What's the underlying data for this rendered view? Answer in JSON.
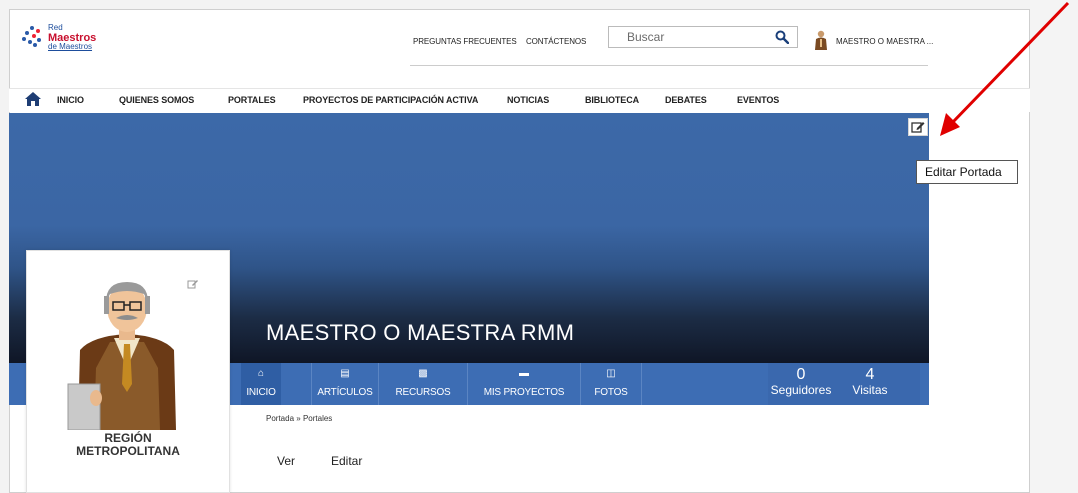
{
  "logo": {
    "line1": "Red",
    "line2": "Maestros",
    "line3": "de Maestros"
  },
  "header": {
    "faq": "PREGUNTAS FRECUENTES",
    "contact": "CONTÁCTENOS",
    "search_placeholder": "Buscar",
    "user_name": "MAESTRO O MAESTRA ..."
  },
  "nav": {
    "items": [
      "INICIO",
      "QUIENES SOMOS",
      "PORTALES",
      "PROYECTOS DE PARTICIPACIÓN ACTIVA",
      "NOTICIAS",
      "BIBLIOTECA",
      "DEBATES",
      "EVENTOS"
    ]
  },
  "banner": {
    "tooltip": "Editar Portada",
    "title": "MAESTRO O MAESTRA RMM"
  },
  "tabs": [
    {
      "label": "INICIO",
      "icon": "home-icon"
    },
    {
      "label": "ARTÍCULOS",
      "icon": "article-icon"
    },
    {
      "label": "RECURSOS",
      "icon": "briefcase-icon"
    },
    {
      "label": "MIS PROYECTOS",
      "icon": "folder-icon"
    },
    {
      "label": "FOTOS",
      "icon": "photos-icon"
    }
  ],
  "stats": {
    "followers_count": "0",
    "followers_label": "Seguidores",
    "visits_count": "4",
    "visits_label": "Visitas"
  },
  "profile": {
    "region_line1": "REGIÓN",
    "region_line2": "METROPOLITANA"
  },
  "breadcrumb": {
    "home": "Portada",
    "separator": "»",
    "current": "Portales"
  },
  "actions": {
    "view": "Ver",
    "edit": "Editar"
  },
  "colors": {
    "brand_blue": "#3d6db4",
    "brand_red": "#c8102e",
    "annotation_arrow": "#e00000"
  }
}
